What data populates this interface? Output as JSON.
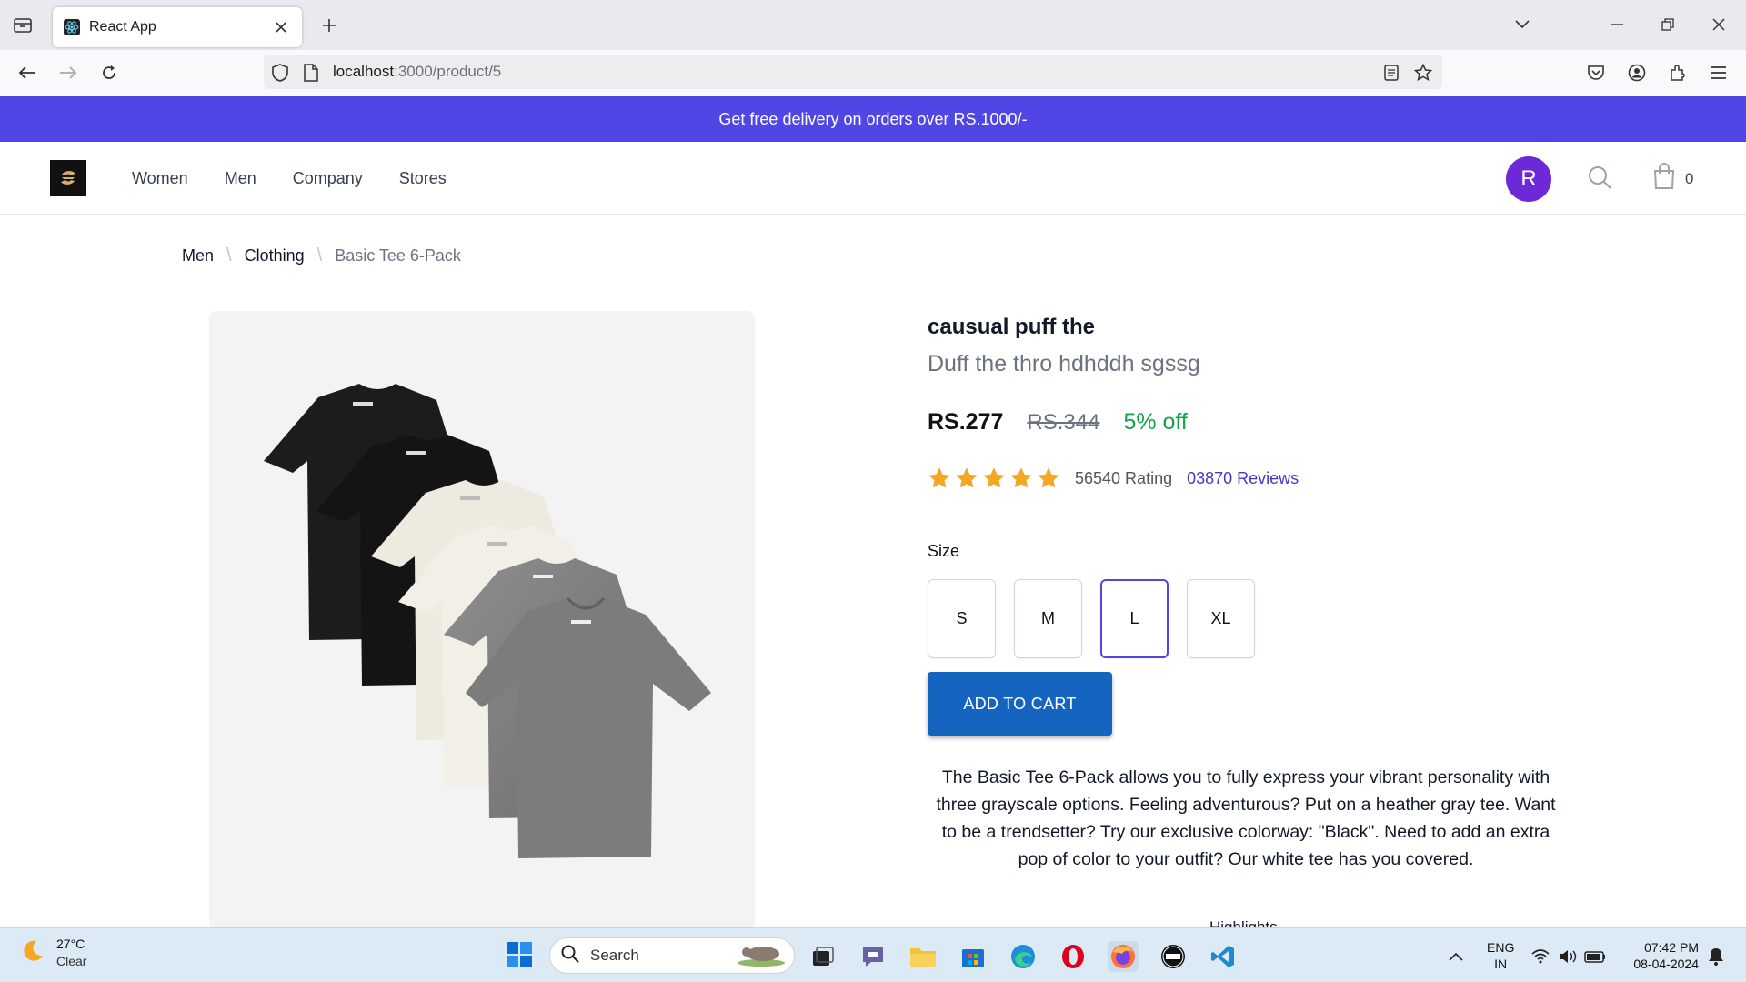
{
  "browser": {
    "tab_title": "React App",
    "url_host": "localhost",
    "url_path": ":3000/product/5"
  },
  "promo": {
    "text": "Get free delivery on orders over RS.1000/-"
  },
  "header": {
    "menu": [
      "Women",
      "Men",
      "Company",
      "Stores"
    ],
    "avatar_initial": "R",
    "cart_count": "0"
  },
  "breadcrumb": {
    "items": [
      "Men",
      "Clothing"
    ],
    "current": "Basic Tee 6-Pack"
  },
  "product": {
    "title": "causual puff the",
    "subtitle": "Duff the thro hdhddh sgssg",
    "price": "RS.277",
    "mrp": "RS.344",
    "discount": "5% off",
    "stars": 5,
    "rating_text": "56540 Rating",
    "reviews_text": "03870 Reviews",
    "size_label": "Size",
    "sizes": [
      "S",
      "M",
      "L",
      "XL"
    ],
    "selected_size": "L",
    "add_to_cart": "ADD TO CART",
    "description": "The Basic Tee 6-Pack allows you to fully express your vibrant personality with three grayscale options. Feeling adventurous? Put on a heather gray tee. Want to be a trendsetter? Try our exclusive colorway: \"Black\". Need to add an extra pop of color to your outfit? Our white tee has you covered.",
    "highlights_label": "Highlights"
  },
  "colors": {
    "promo_bg": "#4f46e5",
    "avatar_bg": "#6d28d9",
    "button_bg": "#1565c0",
    "discount": "#16a34a",
    "star": "#f5a623",
    "review_link": "#4338ca"
  },
  "taskbar": {
    "weather_temp": "27°C",
    "weather_cond": "Clear",
    "search_label": "Search",
    "lang_top": "ENG",
    "lang_bottom": "IN",
    "time": "07:42 PM",
    "date": "08-04-2024"
  }
}
